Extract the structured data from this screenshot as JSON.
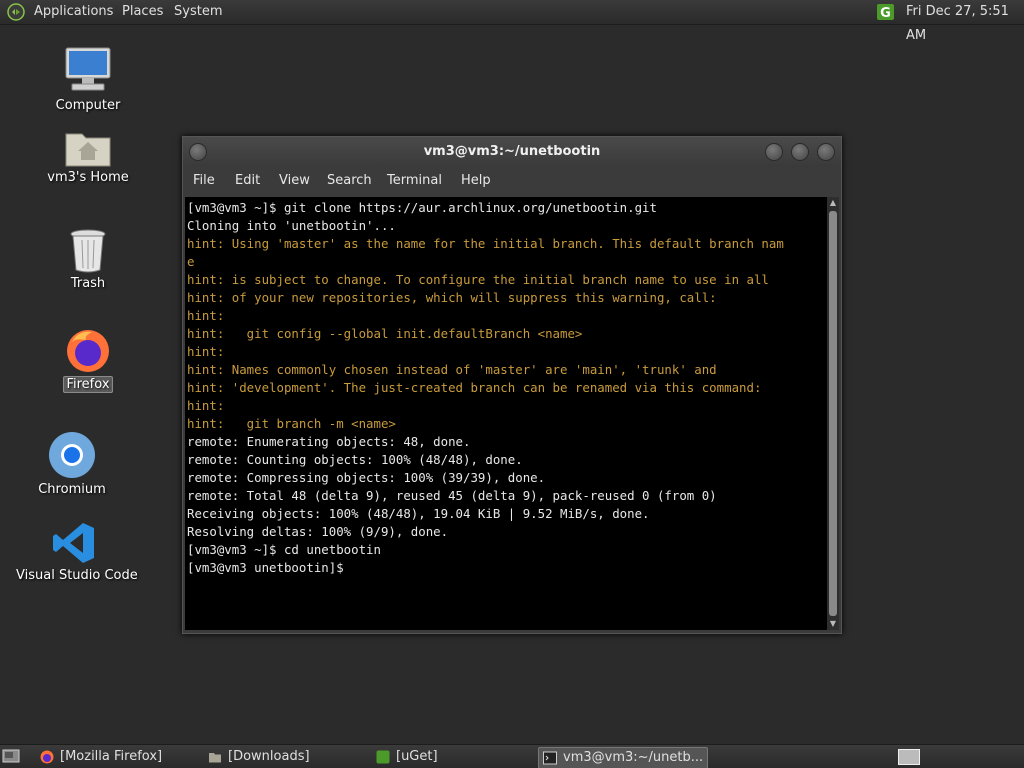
{
  "top_panel": {
    "menus": [
      "Applications",
      "Places",
      "System"
    ],
    "clock": "Fri Dec 27,  5:51 AM"
  },
  "desktop": {
    "icons": [
      {
        "label": "Computer",
        "icon": "computer-icon"
      },
      {
        "label": "vm3's Home",
        "icon": "home-folder-icon"
      },
      {
        "label": "Trash",
        "icon": "trash-icon"
      },
      {
        "label": "Firefox",
        "icon": "firefox-icon"
      },
      {
        "label": "Chromium",
        "icon": "chromium-icon"
      },
      {
        "label": "Visual Studio Code",
        "icon": "vscode-icon"
      }
    ]
  },
  "terminal": {
    "title": "vm3@vm3:~/unetbootin",
    "menu": [
      "File",
      "Edit",
      "View",
      "Search",
      "Terminal",
      "Help"
    ],
    "lines": [
      {
        "text": "[vm3@vm3 ~]$ git clone https://aur.archlinux.org/unetbootin.git",
        "kind": "normal"
      },
      {
        "text": "Cloning into 'unetbootin'...",
        "kind": "normal"
      },
      {
        "text": "hint: Using 'master' as the name for the initial branch. This default branch nam",
        "kind": "hint"
      },
      {
        "text": "e",
        "kind": "hint"
      },
      {
        "text": "hint: is subject to change. To configure the initial branch name to use in all",
        "kind": "hint"
      },
      {
        "text": "hint: of your new repositories, which will suppress this warning, call:",
        "kind": "hint"
      },
      {
        "text": "hint:",
        "kind": "hint"
      },
      {
        "text": "hint:   git config --global init.defaultBranch <name>",
        "kind": "hint"
      },
      {
        "text": "hint:",
        "kind": "hint"
      },
      {
        "text": "hint: Names commonly chosen instead of 'master' are 'main', 'trunk' and",
        "kind": "hint"
      },
      {
        "text": "hint: 'development'. The just-created branch can be renamed via this command:",
        "kind": "hint"
      },
      {
        "text": "hint:",
        "kind": "hint"
      },
      {
        "text": "hint:   git branch -m <name>",
        "kind": "hint"
      },
      {
        "text": "remote: Enumerating objects: 48, done.",
        "kind": "normal"
      },
      {
        "text": "remote: Counting objects: 100% (48/48), done.",
        "kind": "normal"
      },
      {
        "text": "remote: Compressing objects: 100% (39/39), done.",
        "kind": "normal"
      },
      {
        "text": "remote: Total 48 (delta 9), reused 45 (delta 9), pack-reused 0 (from 0)",
        "kind": "normal"
      },
      {
        "text": "Receiving objects: 100% (48/48), 19.04 KiB | 9.52 MiB/s, done.",
        "kind": "normal"
      },
      {
        "text": "Resolving deltas: 100% (9/9), done.",
        "kind": "normal"
      },
      {
        "text": "[vm3@vm3 ~]$ cd unetbootin",
        "kind": "normal"
      },
      {
        "text": "[vm3@vm3 unetbootin]$",
        "kind": "normal"
      }
    ]
  },
  "taskbar": {
    "tasks": [
      {
        "label": "[Mozilla Firefox]",
        "icon": "firefox-icon"
      },
      {
        "label": "[Downloads]",
        "icon": "folder-icon"
      },
      {
        "label": "[uGet]",
        "icon": "uget-icon"
      },
      {
        "label": "vm3@vm3:~/unetb...",
        "icon": "terminal-icon",
        "active": true
      }
    ]
  },
  "colors": {
    "hint": "#c89b3c",
    "terminal_text": "#e8e8e8",
    "terminal_bg": "#000000"
  }
}
